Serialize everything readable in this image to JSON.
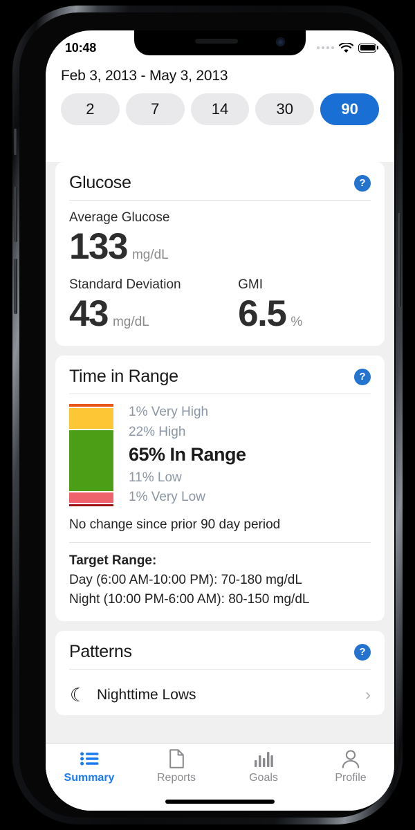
{
  "status_bar": {
    "time": "10:48",
    "signal_icon": "signal-dots-icon",
    "wifi_icon": "wifi-icon",
    "battery_icon": "battery-full-icon"
  },
  "header": {
    "date_range": "Feb 3, 2013 - May 3, 2013",
    "range_pills": [
      {
        "label": "2",
        "active": false
      },
      {
        "label": "7",
        "active": false
      },
      {
        "label": "14",
        "active": false
      },
      {
        "label": "30",
        "active": false
      },
      {
        "label": "90",
        "active": true
      }
    ]
  },
  "glucose_card": {
    "title": "Glucose",
    "help_label": "?",
    "average": {
      "label": "Average Glucose",
      "value": "133",
      "unit": "mg/dL"
    },
    "standard_deviation": {
      "label": "Standard Deviation",
      "value": "43",
      "unit": "mg/dL"
    },
    "gmi": {
      "label": "GMI",
      "value": "6.5",
      "unit": "%"
    }
  },
  "time_in_range_card": {
    "title": "Time in Range",
    "help_label": "?",
    "segments": [
      {
        "label": "1% Very High",
        "percent": 1,
        "color": "#e8561a",
        "primary": false
      },
      {
        "label": "22% High",
        "percent": 22,
        "color": "#fcc634",
        "primary": false
      },
      {
        "label": "65% In Range",
        "percent": 65,
        "color": "#4c9e16",
        "primary": true
      },
      {
        "label": "11% Low",
        "percent": 11,
        "color": "#f0626b",
        "primary": false
      },
      {
        "label": "1% Very Low",
        "percent": 1,
        "color": "#9e0f14",
        "primary": false
      }
    ],
    "change_note": "No change since prior 90 day period",
    "target_range": {
      "title": "Target Range:",
      "day": "Day (6:00 AM-10:00 PM): 70-180 mg/dL",
      "night": "Night (10:00 PM-6:00 AM): 80-150 mg/dL"
    }
  },
  "patterns_card": {
    "title": "Patterns",
    "help_label": "?",
    "rows": [
      {
        "icon": "moon-icon",
        "glyph": "☾",
        "name": "Nighttime Lows",
        "chevron": "›"
      }
    ]
  },
  "tab_bar": {
    "tabs": [
      {
        "label": "Summary",
        "icon": "list-icon",
        "active": true
      },
      {
        "label": "Reports",
        "icon": "document-icon",
        "active": false
      },
      {
        "label": "Goals",
        "icon": "bar-chart-icon",
        "active": false
      },
      {
        "label": "Profile",
        "icon": "person-icon",
        "active": false
      }
    ]
  },
  "colors": {
    "accent": "#1a6fd4",
    "tab_active": "#1a7af0",
    "background": "#f0f0f0",
    "card": "#ffffff",
    "muted_text": "#8b96a4"
  }
}
